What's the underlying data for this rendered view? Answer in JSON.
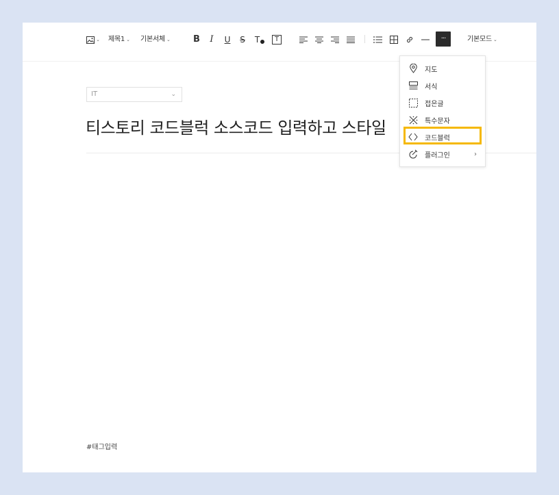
{
  "toolbar": {
    "heading_label": "제목1",
    "font_label": "기본서체",
    "bold": "B",
    "italic": "I",
    "underline": "U",
    "strike": "S",
    "text_color": "T",
    "text_bg": "T",
    "more_label": "···",
    "mode_label": "기본모드"
  },
  "editor": {
    "category_value": "IT",
    "title": "티스토리 코드블럭 소스코드 입력하고 스타일",
    "tag_placeholder": "#태그입력"
  },
  "menu": {
    "items": [
      {
        "label": "지도",
        "icon": "map-pin-icon"
      },
      {
        "label": "서식",
        "icon": "template-icon"
      },
      {
        "label": "접은글",
        "icon": "fold-box-icon"
      },
      {
        "label": "특수문자",
        "icon": "special-char-icon"
      },
      {
        "label": "코드블럭",
        "icon": "code-icon"
      },
      {
        "label": "플러그인",
        "icon": "plugin-icon"
      }
    ],
    "highlighted": "코드블럭",
    "highlight_color": "#f5b800"
  }
}
